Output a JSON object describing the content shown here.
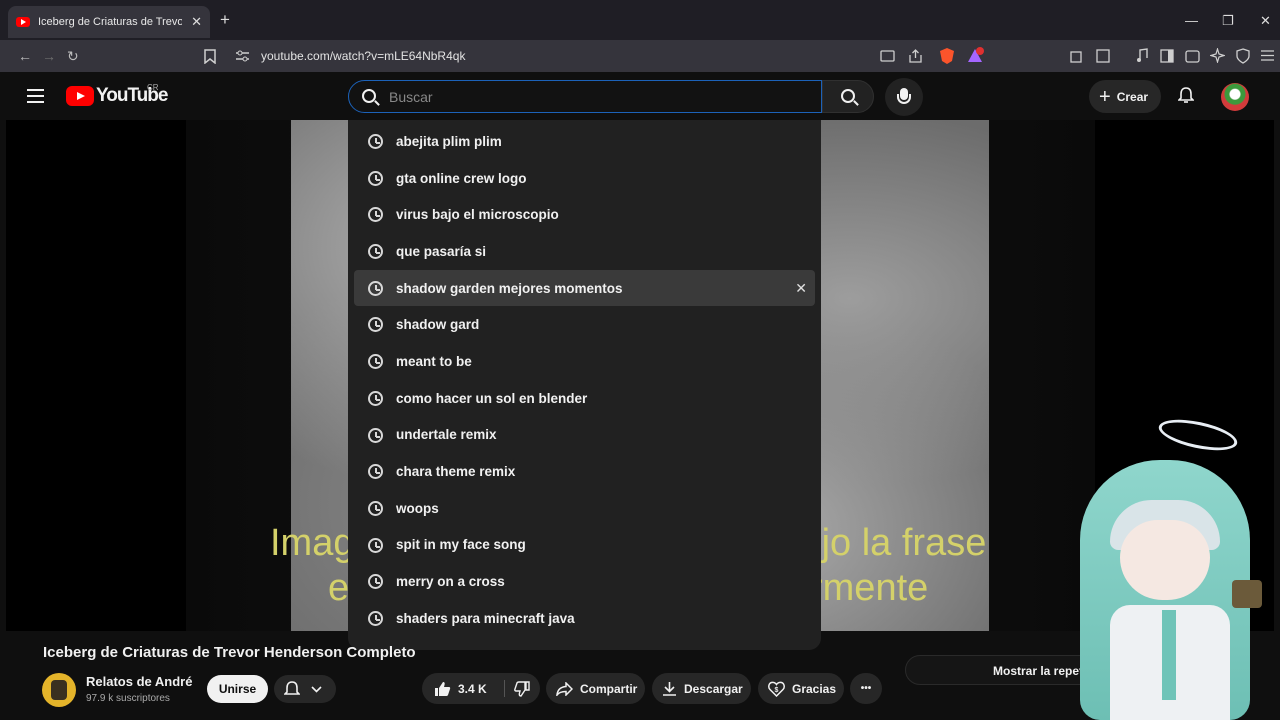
{
  "browser": {
    "tab_title": "Iceberg de Criaturas de Trevor Henderson Completo - YouTube",
    "tab_close": "✕",
    "new_tab": "+",
    "url": "youtube.com/watch?v=mLE64NbR4qk",
    "window_controls": {
      "minimize": "—",
      "maximize": "❐",
      "close": "✕"
    },
    "nav": {
      "back": "←",
      "forward": "→",
      "reload": "↻"
    }
  },
  "youtube": {
    "logo_text": "YouTube",
    "country_code": "CR",
    "search_placeholder": "Buscar",
    "create_label": "Crear",
    "create_icon": "+"
  },
  "suggestions": [
    {
      "text": "abejita plim plim"
    },
    {
      "text": "gta online crew logo"
    },
    {
      "text": "virus bajo el microscopio"
    },
    {
      "text": "que pasaría si"
    },
    {
      "text": "shadow garden mejores momentos",
      "highlighted": true,
      "remove": "✕"
    },
    {
      "text": "shadow gard"
    },
    {
      "text": "meant to be"
    },
    {
      "text": "como hacer un sol en blender"
    },
    {
      "text": "undertale remix"
    },
    {
      "text": "chara theme remix"
    },
    {
      "text": "woops"
    },
    {
      "text": "spit in my face song"
    },
    {
      "text": "merry on a cross"
    },
    {
      "text": "shaders para minecraft java"
    }
  ],
  "video": {
    "subtitle_line1_left": "Imag",
    "subtitle_line2_left": "e",
    "subtitle_line1_right": "dijo la frase",
    "subtitle_line2_right": "rmente",
    "title": "Iceberg de Criaturas de Trevor Henderson Completo"
  },
  "channel": {
    "name": "Relatos de André",
    "subscribers": "97.9 k suscriptores",
    "join_label": "Unirse"
  },
  "actions": {
    "likes": "3.4 K",
    "share": "Compartir",
    "download": "Descargar",
    "thanks": "Gracias",
    "more": "•••"
  },
  "side_panel": {
    "show_label": "Mostrar la repetición del chat"
  }
}
